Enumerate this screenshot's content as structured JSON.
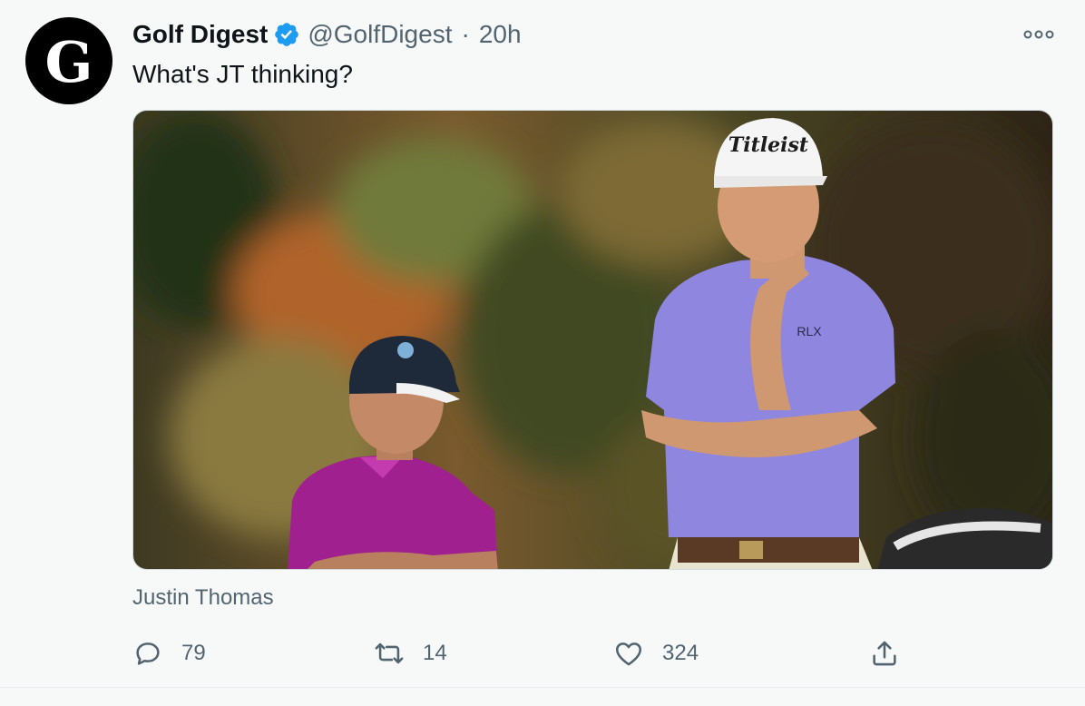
{
  "author": {
    "display_name": "Golf Digest",
    "handle": "@GolfDigest",
    "separator": "·",
    "time": "20h",
    "avatar_letter": "G",
    "verified_color": "#1d9bf0"
  },
  "tweet": {
    "text": "What's JT thinking?",
    "tagged_people": "Justin Thomas"
  },
  "photo": {
    "cap_brand_text": "Titleist",
    "shirt_brand_text": "RLX"
  },
  "actions": {
    "reply_count": "79",
    "retweet_count": "14",
    "like_count": "324"
  },
  "icons": [
    "verified-badge-icon",
    "more-options-icon",
    "reply-icon",
    "retweet-icon",
    "like-icon",
    "share-icon"
  ]
}
